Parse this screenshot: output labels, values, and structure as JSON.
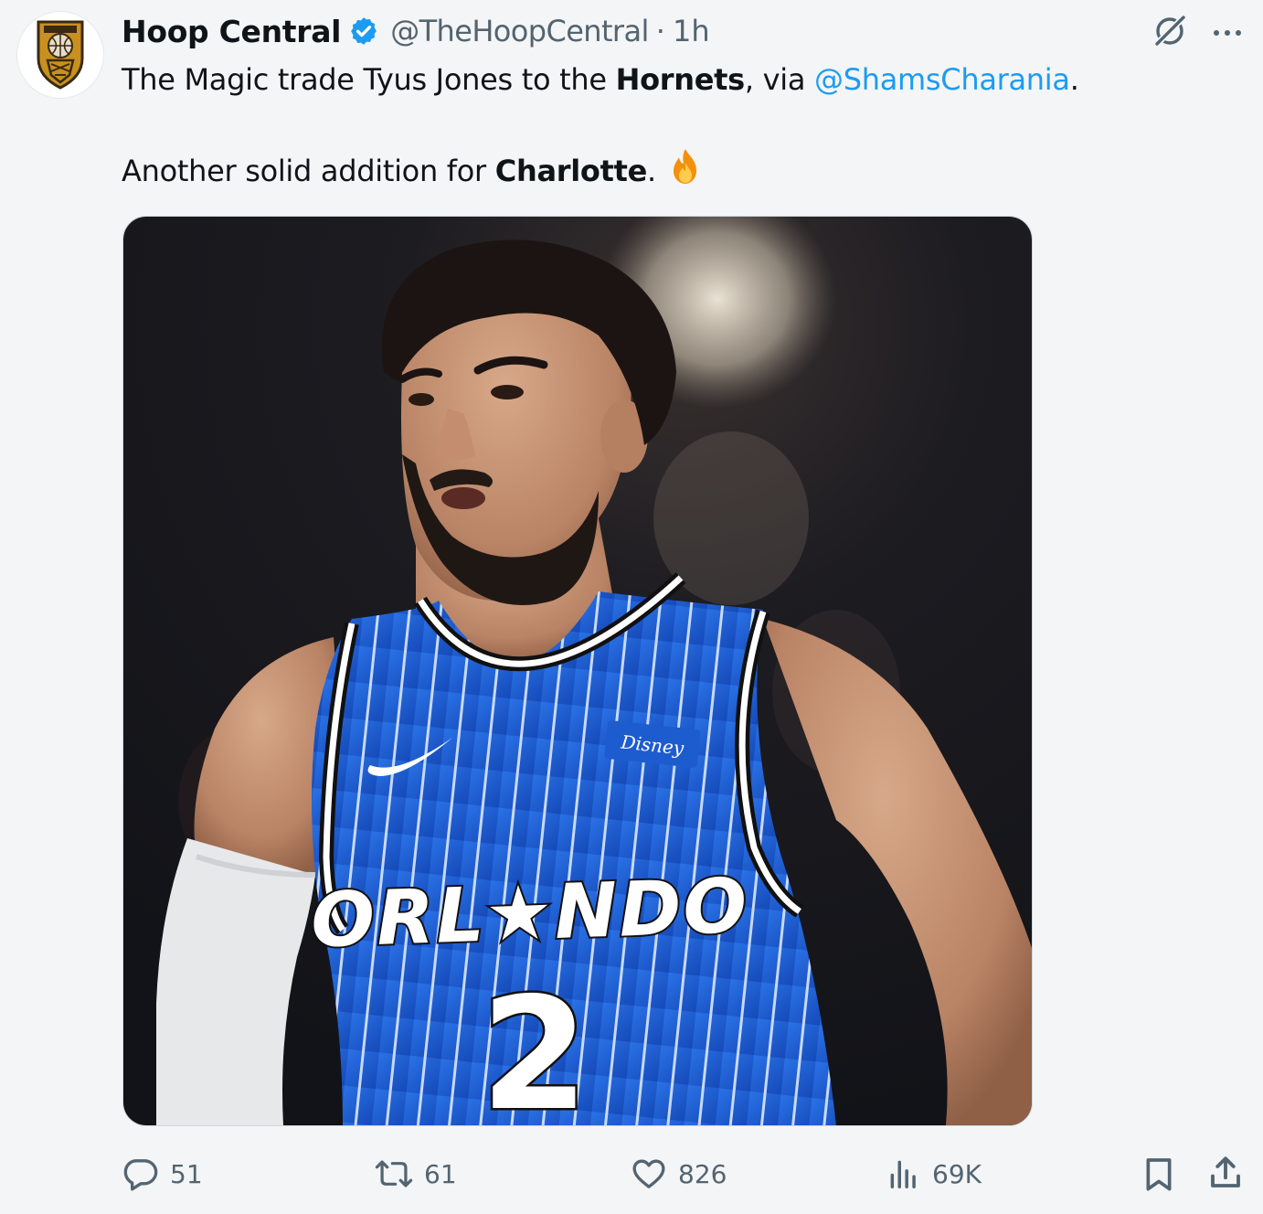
{
  "tweet": {
    "author_name": "Hoop Central",
    "handle": "@TheHoopCentral",
    "separator": "·",
    "time": "1h",
    "line1": {
      "part1": "The Magic trade Tyus Jones to the ",
      "team": "Hornets",
      "part2": ", via ",
      "mention": "@ShamsCharania",
      "part3": "."
    },
    "line2": {
      "part1": "Another solid addition for ",
      "city": "Charlotte",
      "part2": ". ",
      "emoji": "🔥"
    },
    "jersey": {
      "sponsor": "Disney",
      "team_text": "ORL★NDO",
      "number": "2"
    }
  },
  "actions": {
    "replies": "51",
    "reposts": "61",
    "likes": "826",
    "views": "69K"
  },
  "colors": {
    "accent": "#1d9bf0",
    "secondary_text": "#536471",
    "jersey_blue": "#1a5fd0",
    "background": "#f4f5f6"
  },
  "icons": [
    "logo-icon",
    "verified-icon",
    "grok-icon",
    "more-icon",
    "reply-icon",
    "repost-icon",
    "like-icon",
    "views-icon",
    "bookmark-icon",
    "share-icon"
  ]
}
